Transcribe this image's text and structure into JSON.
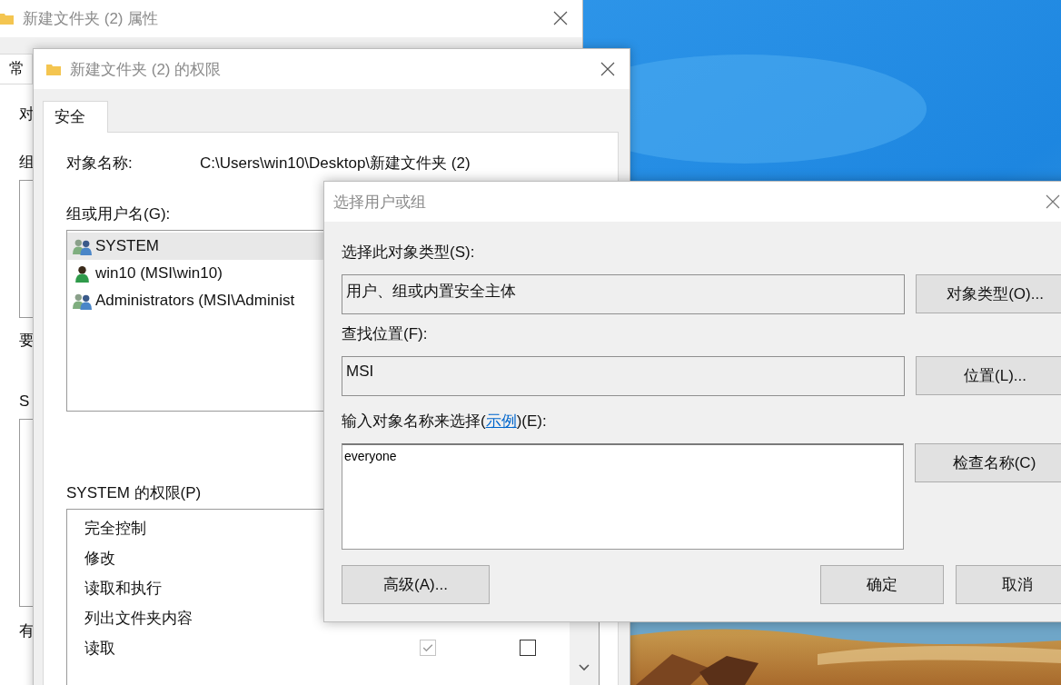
{
  "back_window": {
    "title": "新建文件夹 (2) 属性",
    "tab": "常",
    "fragments": [
      "对",
      "组",
      "要",
      "S",
      "有"
    ]
  },
  "permissions_window": {
    "title": "新建文件夹 (2) 的权限",
    "tabs": [
      {
        "label": "安全",
        "selected": true
      }
    ],
    "object_name_label": "对象名称:",
    "object_name": "C:\\Users\\win10\\Desktop\\新建文件夹 (2)",
    "users_label": "组或用户名(G):",
    "users": [
      {
        "name": "SYSTEM",
        "kind": "group",
        "selected": true
      },
      {
        "name": "win10 (MSI\\win10)",
        "kind": "user",
        "selected": false
      },
      {
        "name": "Administrators (MSI\\Administ",
        "kind": "group",
        "selected": false
      }
    ],
    "permissions_label": "SYSTEM 的权限(P)",
    "permissions": [
      {
        "name": "完全控制"
      },
      {
        "name": "修改"
      },
      {
        "name": "读取和执行"
      },
      {
        "name": "列出文件夹内容"
      },
      {
        "name": "读取",
        "allow": true,
        "deny": false
      }
    ]
  },
  "dialog": {
    "title": "选择用户或组",
    "object_types_label": "选择此对象类型(S):",
    "object_types": "用户、组或内置安全主体",
    "object_types_button": "对象类型(O)...",
    "location_label": "查找位置(F):",
    "location": "MSI",
    "location_button": "位置(L)...",
    "names_label": {
      "before": "输入对象名称来选择(",
      "link": "示例",
      "after": ")(E):"
    },
    "names_value": "everyone",
    "check_names_button": "检查名称(C)",
    "advanced_button": "高级(A)...",
    "ok_button": "确定",
    "cancel_button": "取消"
  }
}
